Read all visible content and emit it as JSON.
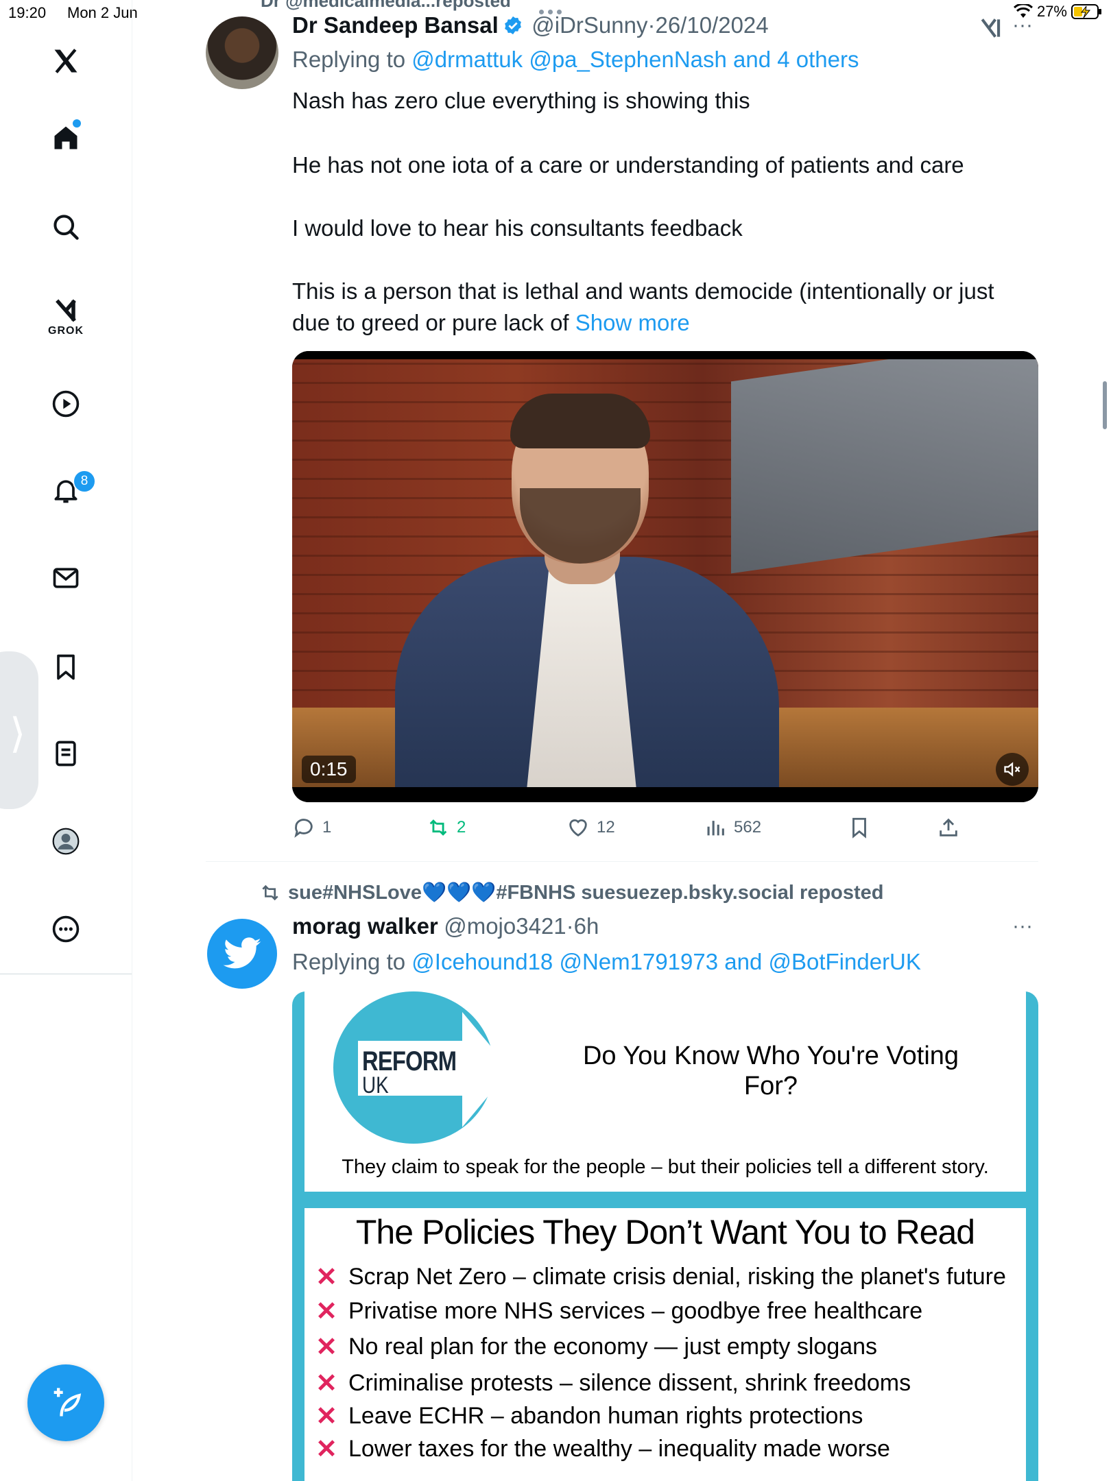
{
  "status_bar": {
    "time": "19:20",
    "date": "Mon 2 Jun",
    "battery": "27%"
  },
  "top_cut_text": "Dr @medicalmedia...reposted",
  "sidebar": {
    "grok_label": "GROK",
    "notifications_badge": "8",
    "items": [
      {
        "name": "x-logo-icon"
      },
      {
        "name": "home-icon"
      },
      {
        "name": "search-icon"
      },
      {
        "name": "grok-icon"
      },
      {
        "name": "video-icon"
      },
      {
        "name": "notifications-icon"
      },
      {
        "name": "messages-icon"
      },
      {
        "name": "bookmarks-icon"
      },
      {
        "name": "lists-icon"
      },
      {
        "name": "profile-icon"
      },
      {
        "name": "more-icon"
      }
    ]
  },
  "tweet1": {
    "name": "Dr Sandeep Bansal",
    "handle": "@iDrSunny",
    "dot": "·",
    "date": "26/10/2024",
    "replying_prefix": "Replying to",
    "replying_to": "@drmattuk @pa_StephenNash and 4 others",
    "lines": [
      "Nash has zero clue everything is showing this",
      "He has not one iota of a care or understanding of patients and care",
      "I would love to hear his consultants feedback",
      "This is a person that is lethal and wants democide (intentionally or just",
      "due to greed or pure lack of"
    ],
    "show_more": "Show more",
    "video_time": "0:15",
    "stats": {
      "replies": "1",
      "reposts": "2",
      "likes": "12",
      "views": "562"
    }
  },
  "tweet2": {
    "repost_line": "sue#NHSLove💙💙💙#FBNHS suesuezep.bsky.social reposted",
    "name": "morag walker",
    "handle": "@mojo3421",
    "dot": "·",
    "time": "6h",
    "replying_prefix": "Replying to",
    "replying_to": "@Icehound18 @Nem1791973 and @BotFinderUK",
    "poster": {
      "reform_line1": "REFORM",
      "reform_line2": "UK",
      "question": "Do You Know Who You're Voting For?",
      "claim": "They claim to speak for the people – but their policies tell a different story.",
      "heading": "The Policies They Don’t Want You to Read",
      "mark": "✕",
      "policies": [
        "Scrap Net Zero – climate crisis denial, risking the planet's future",
        "Privatise more NHS services – goodbye free healthcare",
        "No real plan for the economy — just empty slogans",
        "Criminalise protests – silence dissent, shrink freedoms",
        "Leave ECHR – abandon human rights protections",
        "Lower taxes for the wealthy – inequality made worse"
      ]
    }
  },
  "colors": {
    "accent": "#1d9bf0",
    "repost_green": "#00ba7c",
    "muted": "#536471",
    "poster_blue": "#3fb8d2",
    "cross_red": "#e0245e"
  }
}
